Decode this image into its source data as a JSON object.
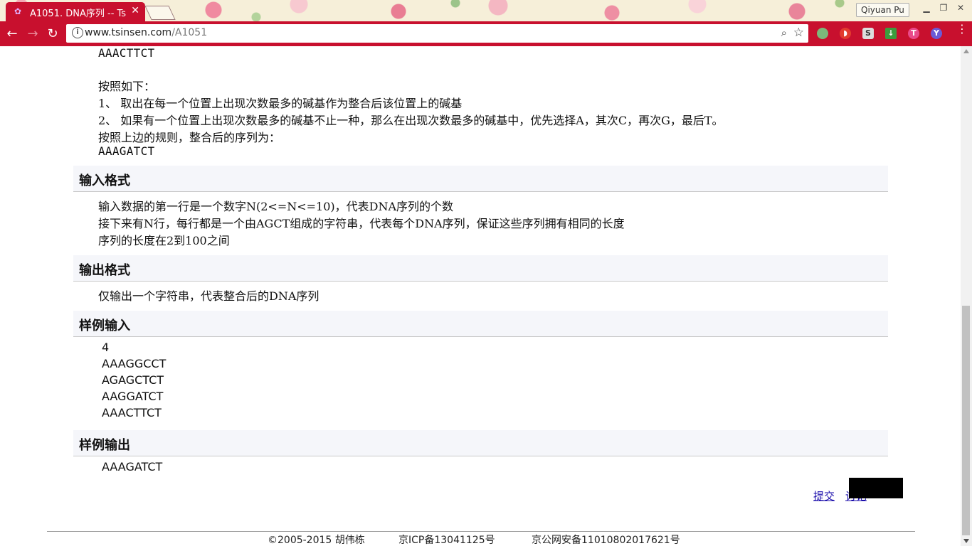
{
  "browser": {
    "tab_title": "A1051. DNA序列 -- Ts",
    "tab_close": "✕",
    "profile_name": "Qiyuan Pu",
    "url_host": "www.tsinsen.com",
    "url_path": "/A1051",
    "accent_color": "#c8102e"
  },
  "problem": {
    "top_fragment": "AAACTTCT",
    "rule_intro": "按照如下：",
    "rule_1": "1、 取出在每一个位置上出现次数最多的碱基作为整合后该位置上的碱基",
    "rule_2": "2、 如果有一个位置上出现次数最多的碱基不止一种，那么在出现次数最多的碱基中，优先选择A，其次C，再次G，最后T。",
    "rule_result_intro": "按照上边的规则，整合后的序列为：",
    "rule_result": "AAAGATCT"
  },
  "input_format": {
    "heading": "输入格式",
    "line1": "输入数据的第一行是一个数字N(2<=N<=10)，代表DNA序列的个数",
    "line2": "接下来有N行，每行都是一个由AGCT组成的字符串，代表每个DNA序列，保证这些序列拥有相同的长度",
    "line3": "序列的长度在2到100之间"
  },
  "output_format": {
    "heading": "输出格式",
    "line1": "仅输出一个字符串，代表整合后的DNA序列"
  },
  "sample_input": {
    "heading": "样例输入",
    "lines": [
      "4",
      "AAAGGCCT",
      "AGAGCTCT",
      "AAGGATCT",
      "AAACTTCT"
    ]
  },
  "sample_output": {
    "heading": "样例输出",
    "line1": "AAAGATCT"
  },
  "actions": {
    "submit": "提交",
    "discuss_partial": "讨论"
  },
  "footer": {
    "copyright": "©2005-2015 胡伟栋",
    "icp": "京ICP备13041125号",
    "police": "京公网安备11010802017621号"
  }
}
